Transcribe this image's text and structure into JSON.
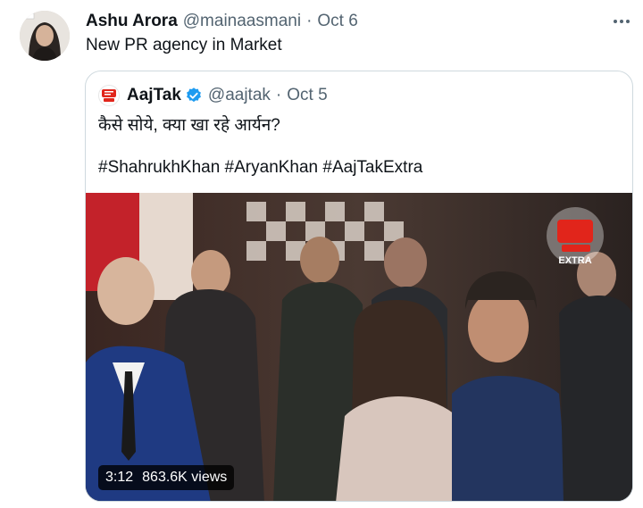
{
  "tweet": {
    "name": "Ashu Arora",
    "handle": "@mainaasmani",
    "separator": "·",
    "date": "Oct 6",
    "text": "New PR agency in Market"
  },
  "quoted": {
    "name": "AajTak",
    "handle": "@aajtak",
    "separator": "·",
    "date": "Oct 5",
    "text_line1": "कैसे सोये, क्या खा रहे आर्यन?",
    "text_line2": "#ShahrukhKhan #AryanKhan #AajTakExtra",
    "logo_text": "आज तक",
    "video": {
      "duration": "3:12",
      "views": "863.6K views",
      "watermark": "EXTRA"
    }
  },
  "colors": {
    "verified": "#1d9bf0",
    "secondary_text": "#536471",
    "border": "#cfd9de",
    "brand_red": "#e1251b"
  }
}
